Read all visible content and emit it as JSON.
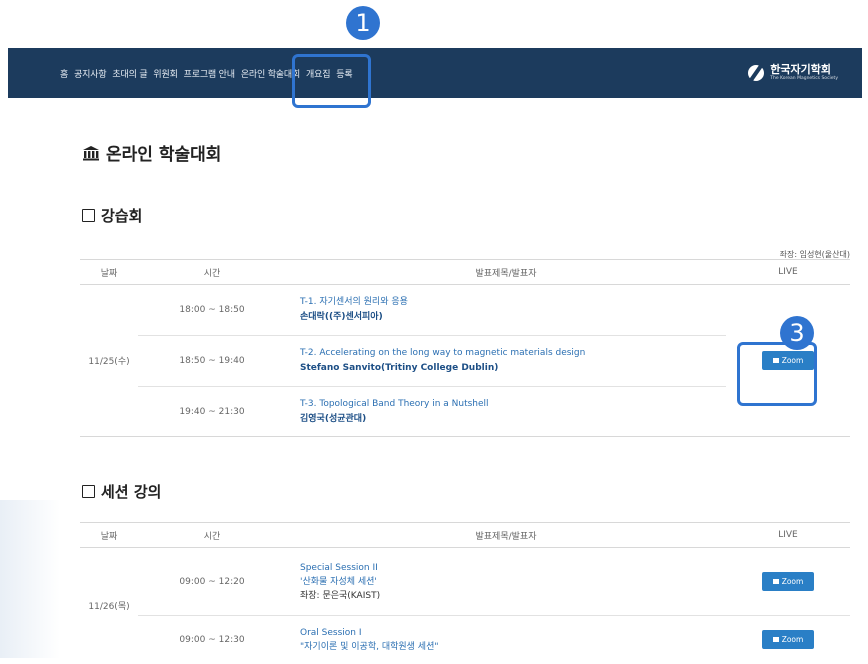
{
  "nav": {
    "items": [
      "홈",
      "공지사항",
      "초대의 글",
      "위원회",
      "프로그램 안내",
      "온라인 학술대회",
      "개요집",
      "등록"
    ],
    "logo_ko": "한국자기학회",
    "logo_en": "The Korean Magnetics Society"
  },
  "annotations": {
    "one": "1",
    "three": "3"
  },
  "page_title": "온라인 학술대회",
  "tutorial": {
    "title": "강습회",
    "chair": "좌장: 임성현(울산대)",
    "headers": [
      "날짜",
      "시간",
      "발표제목/발표자",
      "LIVE"
    ],
    "date": "11/25(수)",
    "rows": [
      {
        "time": "18:00 ~ 18:50",
        "title": "T-1. 자기센서의 원리와 응용",
        "speaker_bold": "손대락",
        "speaker_rest": "((주)센서피아)"
      },
      {
        "time": "18:50 ~ 19:40",
        "title": "T-2. Accelerating on the long way to magnetic materials design",
        "speaker_bold": "Stefano Sanvito",
        "speaker_rest": "(Tritiny College Dublin)"
      },
      {
        "time": "19:40 ~ 21:30",
        "title": "T-3. Topological Band Theory in a Nutshell",
        "speaker_bold": "김영국",
        "speaker_rest": "(성균관대)"
      }
    ],
    "zoom_label": "Zoom"
  },
  "session": {
    "title": "세션 강의",
    "headers": [
      "날짜",
      "시간",
      "발표제목/발표자",
      "LIVE"
    ],
    "date": "11/26(목)",
    "rows": [
      {
        "time": "09:00 ~ 12:20",
        "line1": "Special Session II",
        "line2": "'산화물 자성체 세션'",
        "line3": "좌장: 문은국(KAIST)",
        "zoom": "Zoom"
      },
      {
        "time": "09:00 ~ 12:30",
        "line1": "Oral Session I",
        "line2": "\"자기이론 및 이공학, 대학원생 세션\"",
        "zoom": "Zoom"
      }
    ]
  },
  "colors": {
    "navbar": "#1c3b5d",
    "annotation": "#2f74d0",
    "zoom": "#2a7fc6"
  }
}
